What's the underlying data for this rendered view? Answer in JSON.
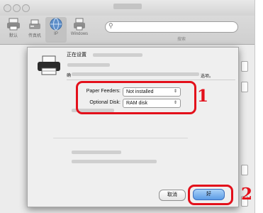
{
  "window": {
    "title": ""
  },
  "toolbar": {
    "items": [
      {
        "label": "默认",
        "icon": "printer-icon"
      },
      {
        "label": "传真机",
        "icon": "fax-icon"
      },
      {
        "label": "IP",
        "icon": "network-globe-icon"
      },
      {
        "label": "Windows",
        "icon": "windows-printer-icon"
      }
    ],
    "search_label": "搜索",
    "search_placeholder": ""
  },
  "dialog": {
    "title": "正在设置",
    "description_start": "确",
    "description_end": "选项。",
    "fields": [
      {
        "label": "Paper Feeders:",
        "value": "Not installed"
      },
      {
        "label": "Optional Disk:",
        "value": "RAM disk"
      }
    ],
    "cancel_label": "取消",
    "ok_label": "好"
  },
  "annotations": {
    "step1": "1",
    "step2": "2"
  },
  "colors": {
    "annotation": "#e3101b",
    "default_button": "#5c9ce6"
  }
}
